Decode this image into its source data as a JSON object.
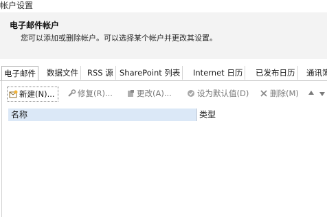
{
  "window": {
    "title": "帐户设置"
  },
  "header": {
    "heading": "电子邮件帐户",
    "description": "您可以添加或删除帐户。可以选择某个帐户并更改其设置。"
  },
  "tabs": [
    {
      "label": "电子邮件",
      "active": true
    },
    {
      "label": "数据文件"
    },
    {
      "label": "RSS 源"
    },
    {
      "label": "SharePoint 列表"
    },
    {
      "label": "Internet 日历"
    },
    {
      "label": "已发布日历"
    },
    {
      "label": "通讯簿"
    }
  ],
  "toolbar": {
    "new_label": "新建(N)...",
    "repair_label": "修复(R)...",
    "change_label": "更改(A)...",
    "default_label": "设为默认值(D)",
    "delete_label": "删除(M)",
    "up_icon": "arrow-up-icon",
    "down_icon": "arrow-down-icon"
  },
  "list": {
    "columns": [
      "名称",
      "类型"
    ],
    "rows": []
  },
  "colors": {
    "header_bg": "#f3f3f3",
    "selected_column": "#dbe8f7"
  }
}
